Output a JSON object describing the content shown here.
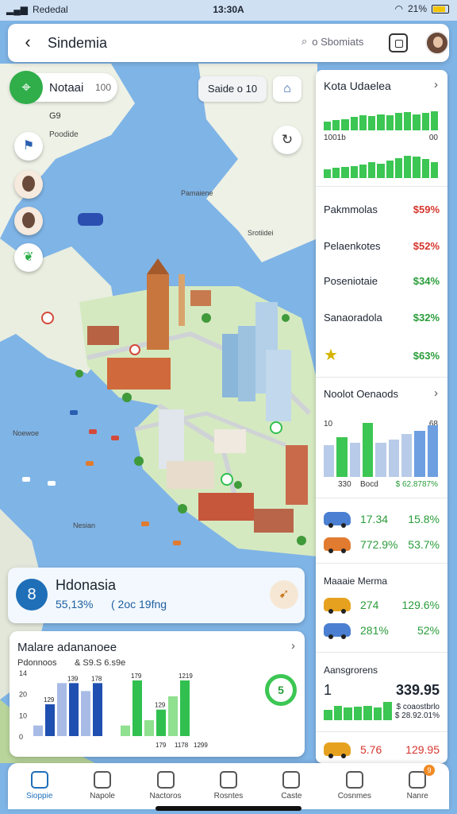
{
  "status": {
    "carrier": "Rededal",
    "time": "13:30A",
    "battery": "21%"
  },
  "header": {
    "title": "Sindemia",
    "search_placeholder": "o Sbomiats"
  },
  "place_chip": {
    "name": "Notaai",
    "value": "100",
    "sub1": "G9",
    "sub2": "Poodide"
  },
  "filter_chip": {
    "label": "Saide o 10"
  },
  "map_labels": [
    "Pamaiene",
    "Srotiidei",
    "Noewoe",
    "Nesian"
  ],
  "right_panel": {
    "section1": {
      "title": "Kota Udaelea",
      "ticks": [
        "1001b",
        "00"
      ],
      "bars_a": [
        0.45,
        0.55,
        0.6,
        0.7,
        0.8,
        0.75,
        0.85,
        0.8,
        0.9,
        0.95,
        0.85,
        0.9,
        1.0
      ],
      "bars_b": [
        0.4,
        0.45,
        0.5,
        0.55,
        0.6,
        0.7,
        0.65,
        0.8,
        0.9,
        1.0,
        0.95,
        0.85,
        0.7
      ]
    },
    "stats": [
      {
        "label": "Pakmmolas",
        "value": "$59%",
        "tone": "red"
      },
      {
        "label": "Pelaenkotes",
        "value": "$52%",
        "tone": "red"
      },
      {
        "label": "Poseniotaie",
        "value": "$34%",
        "tone": "grn"
      },
      {
        "label": "Sanaoradola",
        "value": "$32%",
        "tone": "grn"
      },
      {
        "label": "",
        "value": "$63%",
        "tone": "grn"
      }
    ],
    "section2": {
      "title": "Noolot Oenaods",
      "ticks": [
        "10",
        "68"
      ],
      "bars": [
        {
          "v": 0.55,
          "c": "#b8cbe8"
        },
        {
          "v": 0.7,
          "c": "#3cc653"
        },
        {
          "v": 0.6,
          "c": "#b8cbe8"
        },
        {
          "v": 0.95,
          "c": "#3cc653"
        },
        {
          "v": 0.6,
          "c": "#b8cbe8"
        },
        {
          "v": 0.65,
          "c": "#b8cbe8"
        },
        {
          "v": 0.75,
          "c": "#b8cbe8"
        },
        {
          "v": 0.8,
          "c": "#6e9fe0"
        },
        {
          "v": 0.9,
          "c": "#6e9fe0"
        }
      ],
      "foot_left": "330",
      "foot_mid": "Bocd",
      "foot_right": "$ 62.8787%"
    },
    "cars": [
      {
        "color": "#4a7fd1",
        "a": "17.34",
        "b": "15.8%"
      },
      {
        "color": "#e07b30",
        "a": "772.9%",
        "b": "53.7%"
      }
    ],
    "section3": {
      "title": "Maaaie Merma"
    },
    "cars2": [
      {
        "color": "#e6a21f",
        "a": "274",
        "b": "129.6%"
      },
      {
        "color": "#4a7fd1",
        "a": "281%",
        "b": "52%"
      }
    ],
    "section4": {
      "title": "Aansgrorens",
      "big_left": "1",
      "big_right": "339.95",
      "sub_a": "$ coaostbrlo",
      "sub_b": "$ 28.92.01%",
      "foot_bars": [
        0.5,
        0.7,
        0.6,
        0.65,
        0.7,
        0.6,
        0.9
      ]
    },
    "last_row": {
      "color": "#e6a21f",
      "a": "5.76",
      "b": "129.95"
    }
  },
  "indonesia_card": {
    "badge": "8",
    "name": "Hdonasia",
    "pct": "55,13%",
    "year": "( 2oc 19fng"
  },
  "chart_card": {
    "title": "Malare adananoee",
    "sub1": "Pdonnoos",
    "sub2": "& S9.S 6.s9e",
    "ring_label": "5",
    "chart_data": {
      "type": "bar",
      "y_ticks": [
        "14",
        "20",
        "10",
        "0"
      ],
      "groups": [
        {
          "color_light": "#a7bbe6",
          "color_dark": "#1f4fb0",
          "values": [
            4,
            12,
            20,
            20,
            17,
            20
          ]
        },
        {
          "color_light": "#8fe08f",
          "color_dark": "#31c04f",
          "values": [
            4,
            21,
            6,
            10,
            15,
            21
          ]
        }
      ],
      "value_labels": [
        "129",
        "139",
        "178",
        "179",
        "129",
        "1219",
        "179",
        "1178",
        "1299"
      ]
    }
  },
  "bottom_nav": [
    {
      "label": "Sioppie",
      "active": true
    },
    {
      "label": "Napole",
      "active": false
    },
    {
      "label": "Nactoros",
      "active": false
    },
    {
      "label": "Rosntes",
      "active": false
    },
    {
      "label": "Caste",
      "active": false
    },
    {
      "label": "Cosnmes",
      "active": false
    },
    {
      "label": "Nanre",
      "active": false,
      "badge": "9"
    }
  ]
}
